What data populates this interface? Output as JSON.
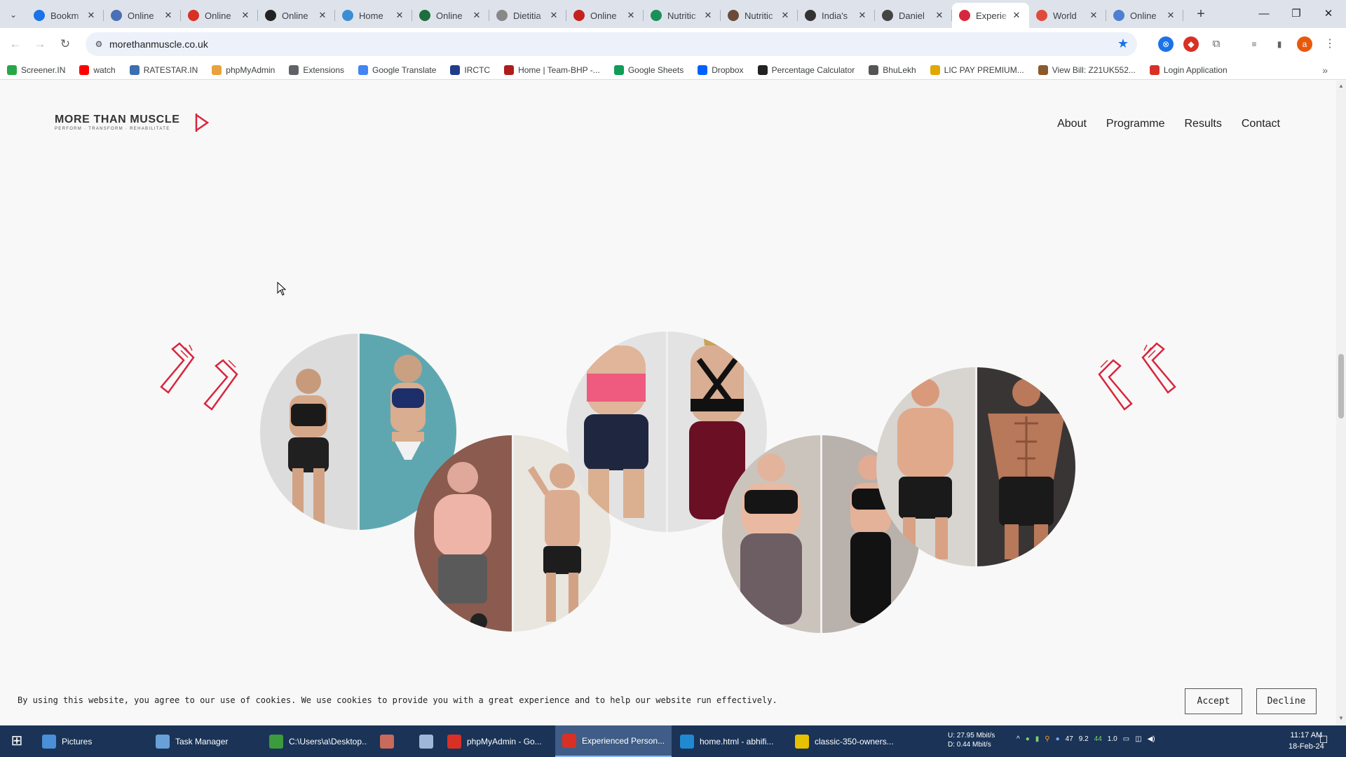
{
  "browser": {
    "tabs": [
      {
        "title": "Bookm",
        "icon": "bookmark-star-icon",
        "color": "#1a73e8"
      },
      {
        "title": "Online",
        "icon": "globe-icon",
        "color": "#4a6fb5"
      },
      {
        "title": "Online",
        "icon": "target-icon",
        "color": "#d93025"
      },
      {
        "title": "Online",
        "icon": "github-icon",
        "color": "#222222"
      },
      {
        "title": "Home",
        "icon": "site-icon",
        "color": "#3b8ed4"
      },
      {
        "title": "Online",
        "icon": "wf-icon",
        "color": "#1d6e3b"
      },
      {
        "title": "Dietitia",
        "icon": "site-icon",
        "color": "#888888"
      },
      {
        "title": "Online",
        "icon": "pdf-icon",
        "color": "#c5221f"
      },
      {
        "title": "Nutritic",
        "icon": "leaf-icon",
        "color": "#1a8f5a"
      },
      {
        "title": "Nutritic",
        "icon": "person-icon",
        "color": "#6b4a3a"
      },
      {
        "title": "India's",
        "icon": "map-pin-icon",
        "color": "#333333"
      },
      {
        "title": "Daniel",
        "icon": "site-icon",
        "color": "#444444"
      },
      {
        "title": "Experie",
        "icon": "mtm-icon",
        "color": "#d7263d",
        "active": true
      },
      {
        "title": "World",
        "icon": "up-icon",
        "color": "#e04a3c"
      },
      {
        "title": "Online",
        "icon": "doc-icon",
        "color": "#4f7fd0"
      }
    ],
    "url": "morethanmuscle.co.uk",
    "bookmarks": [
      {
        "label": "Screener.IN",
        "icon": "bar-chart-icon",
        "color": "#28a745"
      },
      {
        "label": "watch",
        "icon": "youtube-icon",
        "color": "#ff0000"
      },
      {
        "label": "RATESTAR.IN",
        "icon": "star-icon",
        "color": "#3a6fb0"
      },
      {
        "label": "phpMyAdmin",
        "icon": "phpmyadmin-icon",
        "color": "#e9a23b"
      },
      {
        "label": "Extensions",
        "icon": "puzzle-icon",
        "color": "#5f6368"
      },
      {
        "label": "Google Translate",
        "icon": "translate-icon",
        "color": "#4285f4"
      },
      {
        "label": "IRCTC",
        "icon": "irctc-icon",
        "color": "#1f3d8a"
      },
      {
        "label": "Home | Team-BHP -...",
        "icon": "teambhp-icon",
        "color": "#b01c1c"
      },
      {
        "label": "Google Sheets",
        "icon": "sheets-icon",
        "color": "#0f9d58"
      },
      {
        "label": "Dropbox",
        "icon": "dropbox-icon",
        "color": "#0061ff"
      },
      {
        "label": "Percentage Calculator",
        "icon": "percent-icon",
        "color": "#222222"
      },
      {
        "label": "BhuLekh",
        "icon": "globe-icon",
        "color": "#555555"
      },
      {
        "label": "LIC PAY PREMIUM...",
        "icon": "lic-icon",
        "color": "#e0a800"
      },
      {
        "label": "View Bill: Z21UK552...",
        "icon": "bill-icon",
        "color": "#8a5a2b"
      },
      {
        "label": "Login Application",
        "icon": "login-icon",
        "color": "#d93025"
      }
    ]
  },
  "site": {
    "logo_main": "MORE THAN MUSCLE",
    "logo_sub": "PERFORM · TRANSFORM · REHABILITATE",
    "nav": [
      "About",
      "Programme",
      "Results",
      "Contact"
    ],
    "accent": "#d7263d"
  },
  "cookie": {
    "text": "By using this website, you agree to our use of cookies. We use cookies to provide you with a great experience and to help our website run effectively.",
    "accept": "Accept",
    "decline": "Decline"
  },
  "taskbar": {
    "items": [
      {
        "label": "Pictures",
        "icon": "pictures-icon",
        "color": "#4b8fd6"
      },
      {
        "label": "Task Manager",
        "icon": "task-manager-icon",
        "color": "#6aa0d8"
      },
      {
        "label": "C:\\Users\\a\\Desktop...",
        "icon": "notepad-icon",
        "color": "#3c9b3c"
      },
      {
        "label": "",
        "icon": "app-icon",
        "color": "#c96a5a"
      },
      {
        "label": "",
        "icon": "file-icon",
        "color": "#9fb7d8"
      },
      {
        "label": "phpMyAdmin - Go...",
        "icon": "chrome-icon",
        "color": "#d93025"
      },
      {
        "label": "Experienced Person...",
        "icon": "chrome-icon",
        "color": "#d93025",
        "active": true
      },
      {
        "label": "home.html - abhifi...",
        "icon": "vscode-icon",
        "color": "#1f8ad2"
      },
      {
        "label": "classic-350-owners...",
        "icon": "pw-icon",
        "color": "#e5c100"
      }
    ],
    "net_up": "U:   27.95 Mbit/s",
    "net_down": "D:    0.44 Mbit/s",
    "tray": [
      "47",
      "9.2",
      "44",
      "1.0"
    ],
    "time": "11:17 AM",
    "date": "18-Feb-24"
  }
}
